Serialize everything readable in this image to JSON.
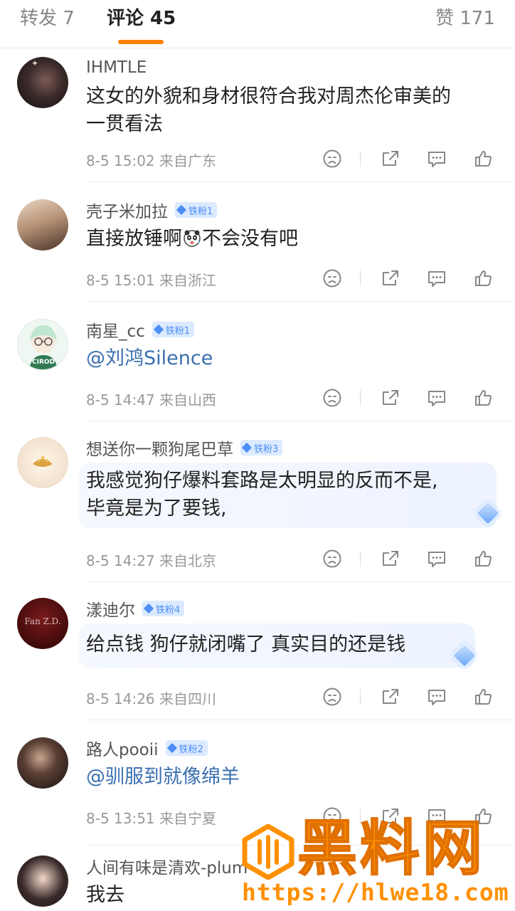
{
  "tabs": {
    "repost": "转发 7",
    "comments": "评论 45",
    "likes": "赞 171"
  },
  "comments": [
    {
      "user": "IHMTLE",
      "badge": "",
      "lines": [
        "这女的外貌和身材很符合我对周杰伦审美的",
        "一贯看法"
      ],
      "meta": "8-5 15:02 来自广东"
    },
    {
      "user": "壳子米加拉",
      "badge": "铁粉1",
      "text_before": "直接放锤啊",
      "text_after": "不会没有吧",
      "meta": "8-5 15:01 来自浙江"
    },
    {
      "user": "南星_cc",
      "badge": "铁粉1",
      "mention": "@刘鸿Silence",
      "avatar_text": "CIROD",
      "meta": "8-5 14:47 来自山西"
    },
    {
      "user": "想送你一颗狗尾巴草",
      "badge": "铁粉3",
      "lines": [
        "我感觉狗仔爆料套路是太明显的反而不是,",
        "毕竟是为了要钱,"
      ],
      "meta": "8-5 14:27 来自北京"
    },
    {
      "user": "漾迪尔",
      "badge": "铁粉4",
      "avatar_text": "Fan Z.D.",
      "text": "给点钱 狗仔就闭嘴了 真实目的还是钱",
      "meta": "8-5 14:26 来自四川"
    },
    {
      "user": "路人pooii",
      "badge": "铁粉2",
      "mention": "@驯服到就像绵羊",
      "meta": "8-5 13:51 来自宁夏"
    },
    {
      "user": "人间有味是清欢-plum",
      "badge": "",
      "text": "我去"
    }
  ],
  "watermark": {
    "title": "黑料网",
    "url": "https://hlwe18.com"
  },
  "colors": {
    "accent": "#ff8200",
    "mention": "#3a6fb0",
    "badge_bg": "#dbeaff",
    "badge_fg": "#4d8ef5",
    "watermark": "#ff9000"
  }
}
